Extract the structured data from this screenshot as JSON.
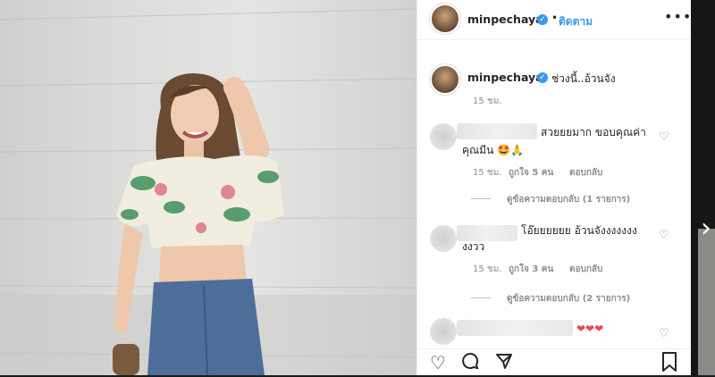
{
  "post": {
    "username": "minpechaya",
    "follow_label": "ติดตาม",
    "caption": "ช่วงนี้..อ้วนจัง",
    "caption_time": "15 ชม."
  },
  "comments": [
    {
      "text_line1": "สวยยยมาก ขอบคุณค่า",
      "text_line2": "คุณมีน 🤩🙏",
      "time": "15 ชม.",
      "likes": "ถูกใจ 5 คน",
      "reply_label": "ตอบกลับ",
      "view_replies": "ดูข้อความตอบกลับ (1 รายการ)"
    },
    {
      "text_line1": "โอ๊ยยยยยย อ้วนจังงงงงงง",
      "text_line2": "งงวว",
      "time": "15 ชม.",
      "likes": "ถูกใจ 3 คน",
      "reply_label": "ตอบกลับ",
      "view_replies": "ดูข้อความตอบกลับ (2 รายการ)"
    },
    {
      "text_line1": "❤❤❤"
    }
  ],
  "icons": {
    "verified": "verified-badge-icon",
    "more": "more-options-icon",
    "heart": "heart-icon",
    "comment": "comment-icon",
    "share": "share-icon",
    "bookmark": "bookmark-icon",
    "next": "chevron-right-icon"
  },
  "colors": {
    "accent": "#3897f0",
    "text": "#262626",
    "muted": "#8e8e8e",
    "heart_red": "#ed4956"
  }
}
